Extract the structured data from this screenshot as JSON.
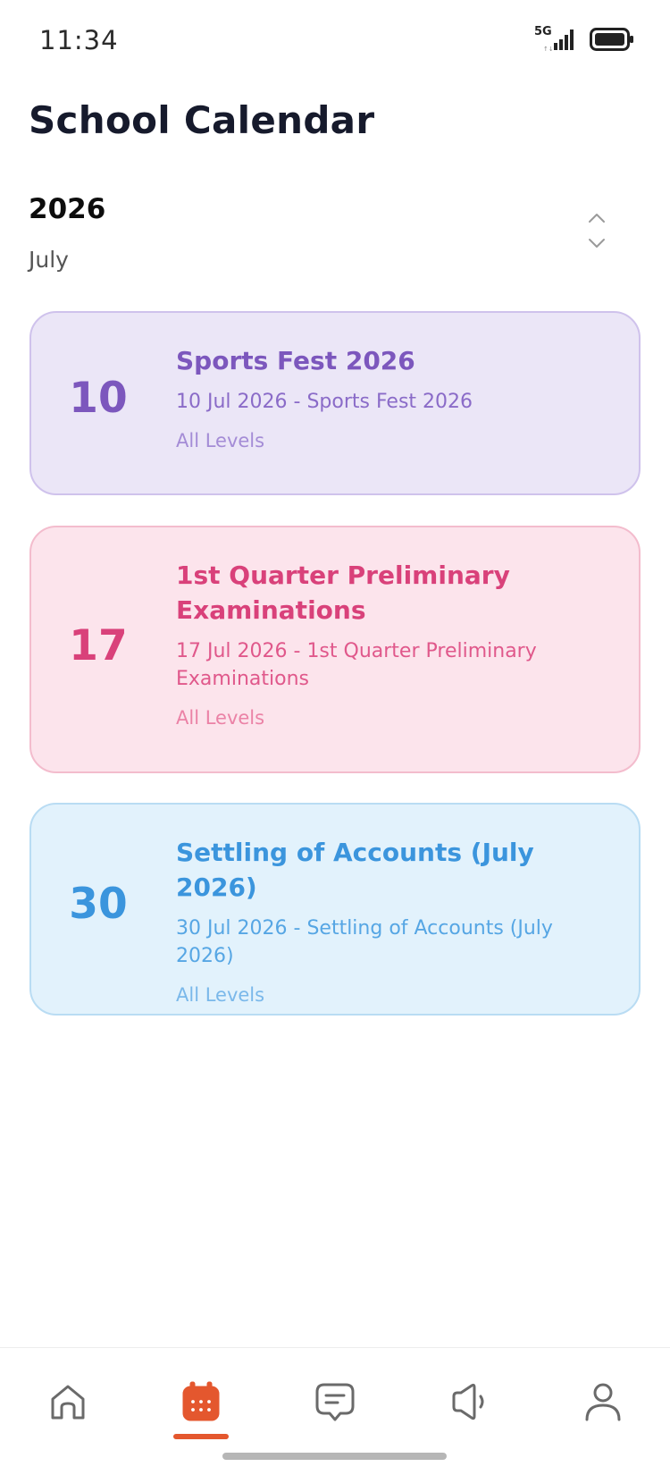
{
  "status_bar": {
    "time": "11:34",
    "network_label": "5G",
    "icons": [
      "signal-icon",
      "battery-icon"
    ]
  },
  "page": {
    "title": "School Calendar"
  },
  "calendar": {
    "year": "2026",
    "month": "July",
    "prev_icon": "chevron-up-icon",
    "next_icon": "chevron-down-icon"
  },
  "events": [
    {
      "day": "10",
      "title": "Sports Fest 2026",
      "detail": "10 Jul 2026 - Sports Fest 2026",
      "level": "All Levels",
      "colors": {
        "bg": "#ebe6f7",
        "border": "#cfc2ec",
        "title": "#7c57bd",
        "detail": "#8a6bc8",
        "level": "#a48cd6"
      }
    },
    {
      "day": "17",
      "title": "1st Quarter Preliminary Examinations",
      "detail": "17 Jul 2026 - 1st Quarter Preliminary Examinations",
      "level": "All Levels",
      "colors": {
        "bg": "#fce4ec",
        "border": "#f3bccd",
        "title": "#d9417a",
        "detail": "#e0588b",
        "level": "#eb82a6"
      }
    },
    {
      "day": "30",
      "title": "Settling of Accounts (July 2026)",
      "detail": "30 Jul 2026 - Settling of Accounts (July 2026)",
      "level": "All Levels",
      "colors": {
        "bg": "#e2f2fc",
        "border": "#b9dcf3",
        "title": "#3b95dd",
        "detail": "#56a6e4",
        "level": "#7ab8ea"
      }
    }
  ],
  "bottom_nav": {
    "items": [
      {
        "icon": "home-icon",
        "active": false
      },
      {
        "icon": "calendar-icon",
        "active": true
      },
      {
        "icon": "chat-icon",
        "active": false
      },
      {
        "icon": "announcement-icon",
        "active": false
      },
      {
        "icon": "profile-icon",
        "active": false
      }
    ],
    "active_color": "#e4572e",
    "inactive_color": "#6a6a6a"
  }
}
